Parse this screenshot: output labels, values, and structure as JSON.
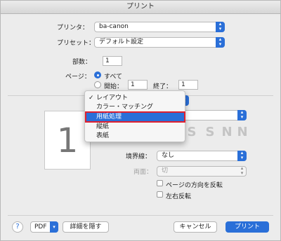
{
  "window": {
    "title": "プリント"
  },
  "printer": {
    "label": "プリンタ：",
    "value": "ba-canon"
  },
  "preset": {
    "label": "プリセット：",
    "value": "デフォルト設定"
  },
  "copies": {
    "label": "部数：",
    "value": "1"
  },
  "pages": {
    "label": "ページ：",
    "all_label": "すべて",
    "from_label": "開始：",
    "from_value": "1",
    "to_label": "終了：",
    "to_value": "1"
  },
  "preview": {
    "page_number": "1"
  },
  "section_menu": {
    "items": [
      {
        "label": "レイアウト",
        "checked": true,
        "selected": false
      },
      {
        "label": "カラー・マッチング",
        "checked": false,
        "selected": false
      },
      {
        "label": "用紙処理",
        "checked": false,
        "selected": true
      },
      {
        "label": "縦紙",
        "checked": false,
        "selected": false
      },
      {
        "label": "表紙",
        "checked": false,
        "selected": false
      }
    ]
  },
  "layout": {
    "orientation_icons": [
      "S",
      "S",
      "N",
      "N"
    ],
    "border": {
      "label": "境界線：",
      "value": "なし"
    },
    "two_sided": {
      "label": "両面：",
      "value": "切"
    },
    "reverse_orientation": {
      "label": "ページの方向を反転",
      "checked": false
    },
    "flip_horizontal": {
      "label": "左右反転",
      "checked": false
    }
  },
  "footer": {
    "help": "?",
    "pdf_label": "PDF",
    "hide_details": "詳細を隠す",
    "cancel": "キャンセル",
    "print": "プリント"
  },
  "colors": {
    "accent": "#2a6fd8",
    "highlight": "#e0202f"
  }
}
